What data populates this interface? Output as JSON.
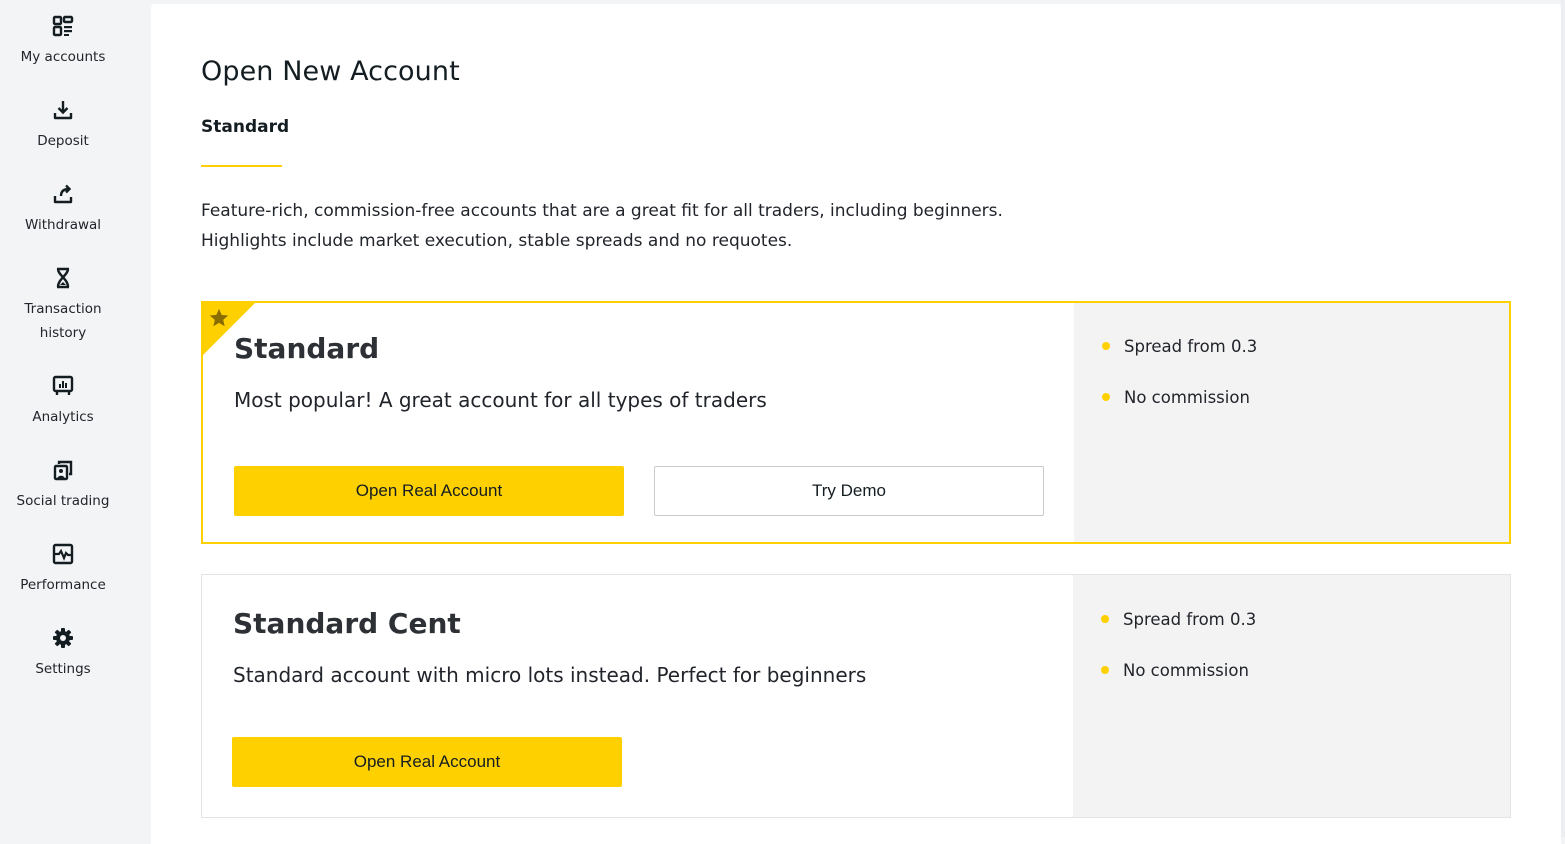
{
  "sidebar": {
    "items": [
      {
        "label": "My accounts",
        "icon": "grid-list-icon"
      },
      {
        "label": "Deposit",
        "icon": "download-tray-icon"
      },
      {
        "label": "Withdrawal",
        "icon": "upload-tray-icon"
      },
      {
        "label": "Transaction history",
        "icon": "hourglass-icon"
      },
      {
        "label": "Analytics",
        "icon": "presentation-chart-icon"
      },
      {
        "label": "Social trading",
        "icon": "social-copies-icon"
      },
      {
        "label": "Performance",
        "icon": "pulse-chart-icon"
      },
      {
        "label": "Settings",
        "icon": "gear-icon"
      }
    ]
  },
  "page": {
    "title": "Open New Account",
    "active_tab": "Standard",
    "description_lines": [
      "Feature-rich, commission-free accounts that are a great fit for all traders, including beginners.",
      "Highlights include market execution, stable spreads and no requotes."
    ]
  },
  "accent_color": "#ffd000",
  "cards": [
    {
      "title": "Standard",
      "subtitle": "Most popular! A great account for all types of traders",
      "featured": true,
      "primary_button": "Open Real Account",
      "secondary_button": "Try Demo",
      "features": [
        "Spread from 0.3",
        "No commission"
      ]
    },
    {
      "title": "Standard Cent",
      "subtitle": "Standard account with micro lots instead. Perfect for beginners",
      "featured": false,
      "primary_button": "Open Real Account",
      "features": [
        "Spread from 0.3",
        "No commission"
      ]
    }
  ]
}
